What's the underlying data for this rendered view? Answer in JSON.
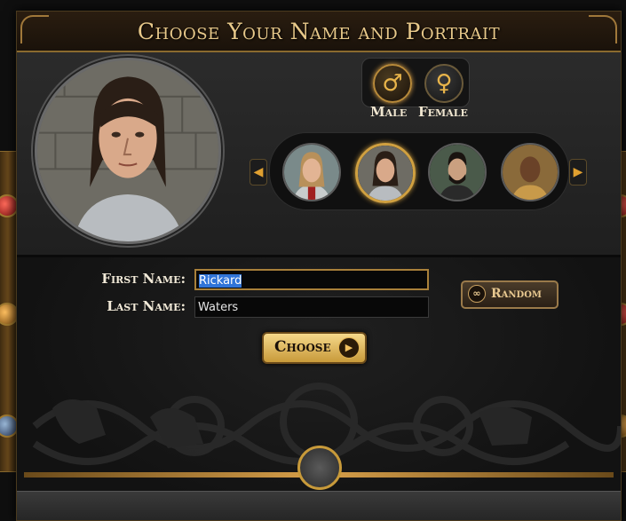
{
  "title": "Choose Your Name and Portrait",
  "gender": {
    "male_label": "Male",
    "female_label": "Female",
    "male_symbol": "♂",
    "female_symbol": "♀",
    "selected": "male"
  },
  "portraits": {
    "selected_index": 1,
    "items": [
      {
        "icon": "blonde-knight-portrait"
      },
      {
        "icon": "dark-haired-knight-portrait"
      },
      {
        "icon": "bearded-man-portrait"
      },
      {
        "icon": "dark-skinned-man-portrait"
      }
    ]
  },
  "form": {
    "first_name_label": "First Name:",
    "last_name_label": "Last Name:",
    "first_name_value": "Rickard",
    "last_name_value": "Waters"
  },
  "buttons": {
    "random_label": "Random",
    "choose_label": "Choose"
  },
  "colors": {
    "gold_accent": "#d0a040",
    "title_text": "#e8c98a"
  }
}
